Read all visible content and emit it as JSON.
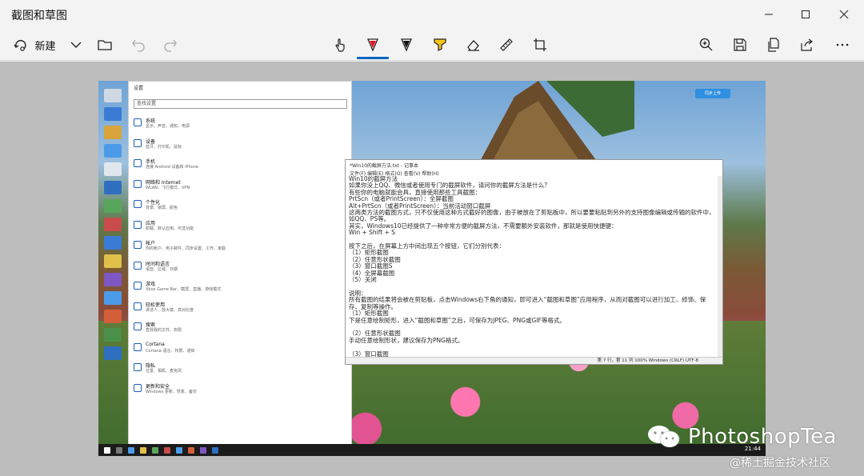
{
  "window": {
    "title": "截图和草图"
  },
  "toolbar": {
    "new_label": "新建",
    "active_tool": "ballpoint-pen"
  },
  "colors": {
    "accent": "#0067c0",
    "toolbar_bg": "#f3f3f3",
    "canvas_bg": "#bdbdbd",
    "ballpoint_pen": "#e81123",
    "highlighter": "#f5c518"
  },
  "screenshot": {
    "settings": {
      "title": "设置",
      "search_placeholder": "查找设置",
      "items": [
        {
          "name": "系统",
          "desc": "显示、声音、通知、电源"
        },
        {
          "name": "设备",
          "desc": "蓝牙、打印机、鼠标"
        },
        {
          "name": "手机",
          "desc": "连接 Android 设备和 iPhone"
        },
        {
          "name": "网络和 Internet",
          "desc": "WLAN、飞行模式、VPN"
        },
        {
          "name": "个性化",
          "desc": "背景、锁屏、颜色"
        },
        {
          "name": "应用",
          "desc": "卸载、默认应用、可选功能"
        },
        {
          "name": "帐户",
          "desc": "你的帐户、电子邮件、同步设置、工作、家庭"
        },
        {
          "name": "时间和语言",
          "desc": "语音、区域、日期"
        },
        {
          "name": "游戏",
          "desc": "Xbox Game Bar、截屏、直播、游戏模式"
        },
        {
          "name": "轻松使用",
          "desc": "讲述人、放大镜、高对比度"
        },
        {
          "name": "搜索",
          "desc": "查找我的文件、权限"
        },
        {
          "name": "Cortana",
          "desc": "Cortana 语言、权限、通知"
        },
        {
          "name": "隐私",
          "desc": "位置、相机、麦克风"
        },
        {
          "name": "更新和安全",
          "desc": "Windows 更新、恢复、备份"
        }
      ]
    },
    "notepad": {
      "title": "*Win10的截屏方法.txt - 记事本",
      "menu": "文件(F)  编辑(E)  格式(O)  查看(V)  帮助(H)",
      "text": "Win10的截屏方法\n如果你没上QQ、微信或者使用专门的截屏软件，请问你的截屏方法是什么？\n有些你的电脑就能会具，直接使用那些工具截图：\nPrtScn（或者PrintScreen）：全屏截图\nAlt+PrtScn（或者PrintScreen）：当前活动窗口截屏\n这两类方法的截图方式，只不仅使用这种方式截好的图像，由于被放在了剪贴板中，所以要要粘贴到另外的支持图像编辑或传输的软件中，如QQ、PS等。\n其实，Windows10已经提供了一种非常方便的截屏方法，不需要额外安装软件，那就是使用快捷键：\nWin + Shift + S\n\n按下之后，在屏幕上方中间出现五个按钮，它们分别代表：\n（1）矩形截图\n（2）任意形状截图\n（3）窗口截图S\n（4）全屏幕截图\n（5）关闭\n\n说明：\n所有截图的结果将会被在剪贴板，点击Windows右下角的通知，即可进入“截图和草图”应用程序，从而对截图可以进行加工、修饰、保存、复制等操作。\n（1）矩形截图\n下是任意绘制矩形，进入“截图和草图”之后，可保存为JPEG、PNG或GIF等格式。\n\n（2）任意形状截图\n手动任意绘制形状，建议保存为PNG格式。\n\n（3）窗口截图\n",
      "status": "第 7 行，第 11 列    100%    Windows (CRLF)    UTF-8"
    },
    "taskbar_time": "21:44",
    "cloud_badge": "同步上传"
  },
  "watermarks": {
    "brand": "PhotoshopTea",
    "community": "@稀土掘金技术社区"
  }
}
